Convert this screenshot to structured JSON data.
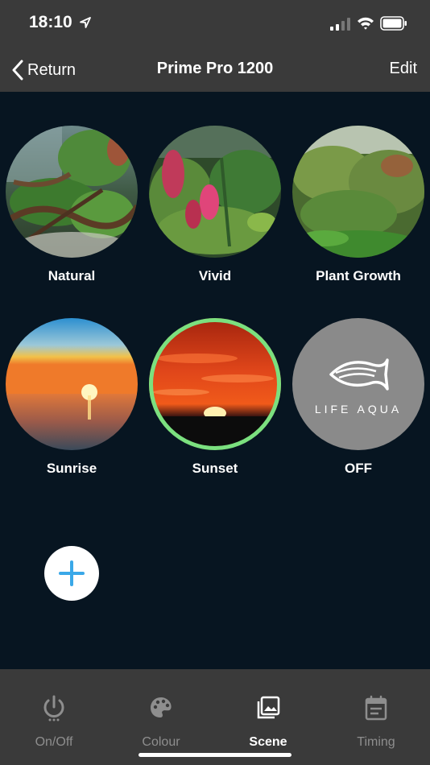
{
  "status": {
    "time": "18:10"
  },
  "nav": {
    "back_label": "Return",
    "title": "Prime Pro 1200",
    "edit_label": "Edit"
  },
  "scenes": [
    {
      "label": "Natural",
      "selected": false
    },
    {
      "label": "Vivid",
      "selected": false
    },
    {
      "label": "Plant Growth",
      "selected": false
    },
    {
      "label": "Sunrise",
      "selected": false
    },
    {
      "label": "Sunset",
      "selected": true
    },
    {
      "label": "OFF",
      "selected": false,
      "logo_text": "LIFE AQUA"
    }
  ],
  "tabs": [
    {
      "label": "On/Off",
      "active": false,
      "icon": "power-icon"
    },
    {
      "label": "Colour",
      "active": false,
      "icon": "palette-icon"
    },
    {
      "label": "Scene",
      "active": true,
      "icon": "image-gallery-icon"
    },
    {
      "label": "Timing",
      "active": false,
      "icon": "calendar-icon"
    }
  ],
  "colors": {
    "background": "#071521",
    "bar": "#3a3a3a",
    "selected_ring": "#7be07f",
    "add_plus": "#3aa8e8"
  }
}
